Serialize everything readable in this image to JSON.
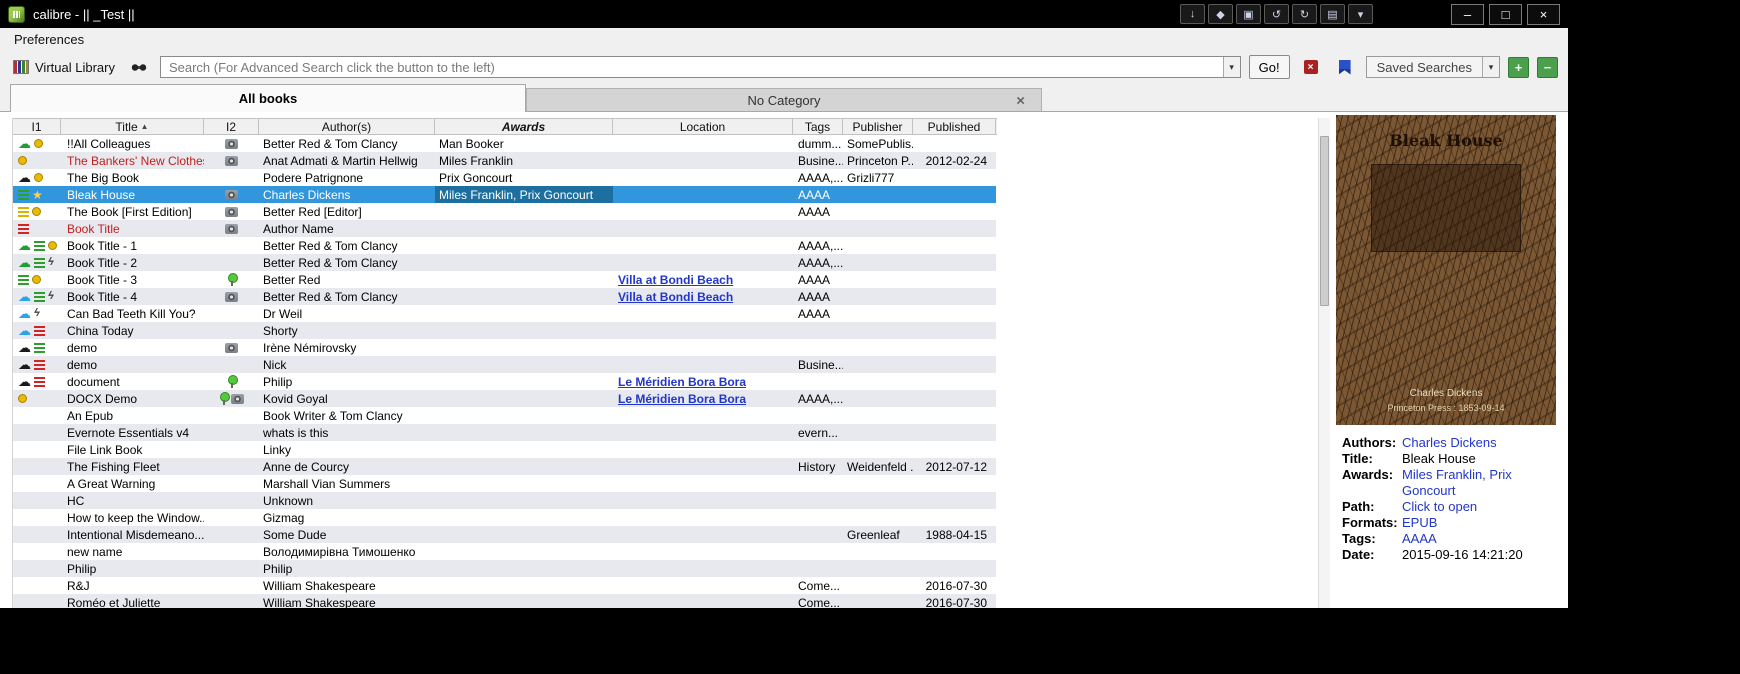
{
  "window": {
    "title": "calibre - || _Test ||",
    "controls": {
      "minimize": "–",
      "maximize": "□",
      "close": "×"
    },
    "tool_buttons": [
      {
        "glyph": "↓",
        "name": "titlebar-tool-1"
      },
      {
        "glyph": "◆",
        "name": "titlebar-tool-2"
      },
      {
        "glyph": "▣",
        "name": "titlebar-tool-3"
      },
      {
        "glyph": "↺",
        "name": "titlebar-tool-4"
      },
      {
        "glyph": "↻",
        "name": "titlebar-tool-5"
      },
      {
        "glyph": "▤",
        "name": "titlebar-tool-6"
      },
      {
        "glyph": "▾",
        "name": "titlebar-tool-menu"
      }
    ]
  },
  "menubar": {
    "items": [
      {
        "label": "Preferences"
      }
    ]
  },
  "toolbar": {
    "virtual_library": "Virtual Library",
    "search": {
      "placeholder": "Search (For Advanced Search click the button to the left)",
      "value": ""
    },
    "go_label": "Go!",
    "saved_searches_label": "Saved Searches",
    "add_label": "+",
    "remove_label": "−"
  },
  "icons": {
    "dropdown": "▾",
    "tab_close": "×"
  },
  "colors": {
    "selection_row": "#3296dc",
    "selected_cell": "#1d6f9f",
    "link_blue": "#2236c8",
    "red_title": "#c21f1f",
    "alt_row": "#e7e9ee"
  },
  "tabs": [
    {
      "label": "All books",
      "active": true
    },
    {
      "label": "No Category",
      "active": false,
      "closable": true
    }
  ],
  "table": {
    "columns": [
      {
        "key": "i1",
        "label": "I1"
      },
      {
        "key": "title",
        "label": "Title",
        "sort": "▲"
      },
      {
        "key": "i2",
        "label": "I2"
      },
      {
        "key": "author",
        "label": "Author(s)"
      },
      {
        "key": "awards",
        "label": "Awards"
      },
      {
        "key": "location",
        "label": "Location"
      },
      {
        "key": "tags",
        "label": "Tags"
      },
      {
        "key": "publisher",
        "label": "Publisher"
      },
      {
        "key": "published",
        "label": "Published"
      }
    ],
    "rows": [
      {
        "i1": [
          "cloud-green",
          "dot-yellow"
        ],
        "title": "!!All Colleagues",
        "i2": [
          "camera"
        ],
        "author": "Better Red & Tom Clancy",
        "awards": "Man Booker",
        "tags": "dumm...",
        "publisher": "SomePublis..."
      },
      {
        "i1": [
          "dot-yellow"
        ],
        "title": "The Bankers' New Clothes",
        "red": true,
        "i2": [
          "camera"
        ],
        "author": "Anat Admati & Martin Hellwig",
        "awards": "Miles Franklin",
        "tags": "Busine...",
        "publisher": "Princeton P...",
        "published": "2012-02-24"
      },
      {
        "i1": [
          "cloud-black",
          "dot-yellow"
        ],
        "title": "The Big Book",
        "author": "Podere Patrignone",
        "awards": "Prix Goncourt",
        "tags": "AAAA,...",
        "publisher": "Grizli777"
      },
      {
        "selected": true,
        "i1": [
          "list-green",
          "star-yellow"
        ],
        "title": "Bleak House",
        "i2": [
          "camera"
        ],
        "author": "Charles Dickens",
        "awards": "Miles Franklin, Prix Goncourt",
        "tags": "AAAA"
      },
      {
        "i1": [
          "list-yellow",
          "dot-yellow"
        ],
        "title": "The Book [First Edition]",
        "i2": [
          "camera"
        ],
        "author": "Better Red [Editor]",
        "tags": "AAAA"
      },
      {
        "i1": [
          "list-red"
        ],
        "title": "Book Title",
        "red": true,
        "i2": [
          "camera"
        ],
        "author": "Author Name"
      },
      {
        "i1": [
          "cloud-green",
          "list-green",
          "dot-yellow"
        ],
        "title": "Book Title -  1",
        "author": "Better Red & Tom Clancy",
        "tags": "AAAA,..."
      },
      {
        "i1": [
          "cloud-green",
          "list-green",
          "bolt"
        ],
        "title": "Book Title -  2",
        "author": "Better Red & Tom Clancy",
        "tags": "AAAA,..."
      },
      {
        "i1": [
          "list-green",
          "dot-yellow"
        ],
        "title": "Book Title -  3",
        "i2": [
          "pin"
        ],
        "author": "Better Red",
        "location": "Villa at Bondi Beach",
        "tags": "AAAA"
      },
      {
        "i1": [
          "cloud-blue",
          "list-green",
          "bolt"
        ],
        "title": "Book Title -  4",
        "i2": [
          "camera"
        ],
        "author": "Better Red & Tom Clancy",
        "location": "Villa at Bondi Beach",
        "tags": "AAAA"
      },
      {
        "i1": [
          "cloud-blue",
          "bolt"
        ],
        "title": "Can Bad Teeth Kill You?",
        "author": "Dr Weil",
        "tags": "AAAA"
      },
      {
        "i1": [
          "cloud-blue",
          "list-red"
        ],
        "title": "China Today",
        "author": "Shorty"
      },
      {
        "i1": [
          "cloud-black",
          "list-green"
        ],
        "title": "demo",
        "i2": [
          "camera"
        ],
        "author": "Irène Némirovsky"
      },
      {
        "i1": [
          "cloud-black",
          "list-red"
        ],
        "title": "demo",
        "author": "Nick",
        "tags": "Busine..."
      },
      {
        "i1": [
          "cloud-black",
          "list-red"
        ],
        "title": "document",
        "i2": [
          "pin"
        ],
        "author": "Philip",
        "location": "Le Méridien Bora Bora"
      },
      {
        "i1": [
          "dot-yellow"
        ],
        "title": "DOCX Demo",
        "i2": [
          "pin",
          "camera"
        ],
        "author": "Kovid Goyal",
        "location": "Le Méridien Bora Bora",
        "tags": "AAAA,..."
      },
      {
        "title": "An Epub",
        "author": "Book Writer & Tom Clancy"
      },
      {
        "title": "Evernote Essentials v4",
        "author": "whats is this",
        "tags": "evern..."
      },
      {
        "title": "File Link Book",
        "author": "Linky"
      },
      {
        "title": "The Fishing Fleet",
        "author": "Anne de Courcy",
        "tags": "History",
        "publisher": "Weidenfeld ...",
        "published": "2012-07-12"
      },
      {
        "title": "A Great Warning",
        "author": "Marshall Vian Summers"
      },
      {
        "title": "HC",
        "author": "Unknown"
      },
      {
        "title": "How to keep the Window...",
        "author": "Gizmag"
      },
      {
        "title": "Intentional Misdemeano...",
        "author": "Some Dude",
        "publisher": "Greenleaf",
        "published": "1988-04-15"
      },
      {
        "title": "new name",
        "author": "Володимирівна Тимошенко"
      },
      {
        "title": "Philip",
        "author": "Philip"
      },
      {
        "title": "R&J",
        "author": "William Shakespeare",
        "tags": "Come...",
        "published": "2016-07-30"
      },
      {
        "title": "Roméo et Juliette",
        "author": "William Shakespeare",
        "tags": "Come...",
        "published": "2016-07-30"
      }
    ]
  },
  "details": {
    "cover": {
      "title": "Bleak House",
      "author": "Charles Dickens",
      "imprint": "Princeton Press : 1853-09-14"
    },
    "fields": [
      {
        "label": "Authors:",
        "value": "Charles Dickens",
        "link": true
      },
      {
        "label": "Title:",
        "value": "Bleak House",
        "link": false
      },
      {
        "label": "Awards:",
        "value": "Miles Franklin, Prix Goncourt",
        "link": true
      },
      {
        "label": "Path:",
        "value": "Click to open",
        "link": true
      },
      {
        "label": "Formats:",
        "value": "EPUB",
        "link": true
      },
      {
        "label": "Tags:",
        "value": "AAAA",
        "link": true
      },
      {
        "label": "Date:",
        "value": "2015-09-16 14:21:20",
        "link": false
      }
    ]
  }
}
